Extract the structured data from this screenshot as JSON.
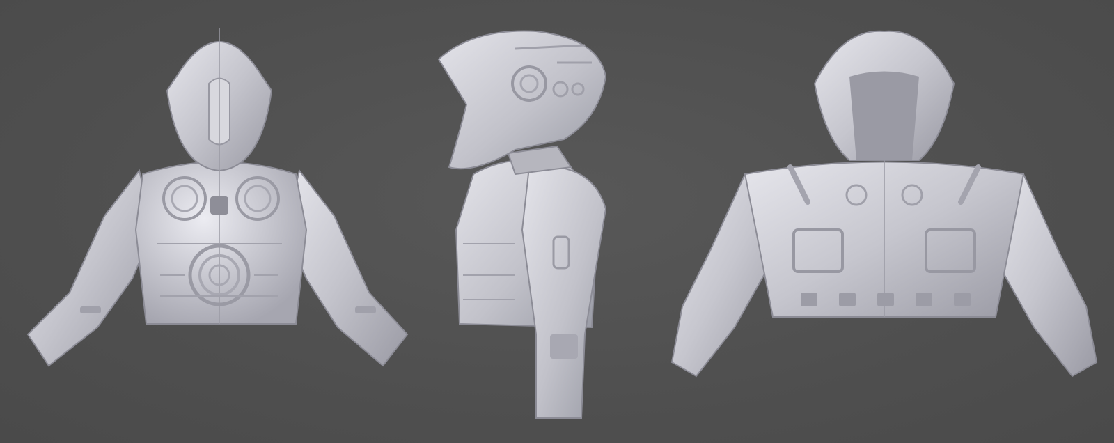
{
  "scene": {
    "background_color": "#515151",
    "material_color": "#c9c9d0",
    "views": [
      {
        "id": "front",
        "icon": "armor-front-view"
      },
      {
        "id": "side",
        "icon": "armor-side-view"
      },
      {
        "id": "back",
        "icon": "armor-back-view"
      }
    ]
  }
}
